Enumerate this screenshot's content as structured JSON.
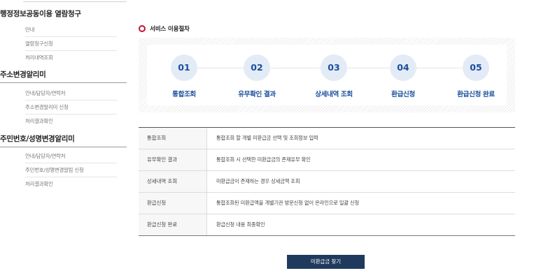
{
  "sidebar": {
    "sections": [
      {
        "title": "행정정보공동이용 열람청구",
        "items": [
          "안내",
          "열람청구신청",
          "처리내역조회"
        ]
      },
      {
        "title": "주소변경알리미",
        "items": [
          "안내/담당자/연락처",
          "주소변경알리미 신청",
          "처리결과확인"
        ]
      },
      {
        "title": "주민번호/성명변경알리미",
        "items": [
          "안내/담당자/연락처",
          "주민번호/성명변경알림 신청",
          "처리결과확인"
        ]
      }
    ]
  },
  "main": {
    "section_title": "서비스 이용절차",
    "steps": [
      {
        "num": "01",
        "label": "통합조회"
      },
      {
        "num": "02",
        "label": "유무확인 결과"
      },
      {
        "num": "03",
        "label": "상세내역 조회"
      },
      {
        "num": "04",
        "label": "환급신청"
      },
      {
        "num": "05",
        "label": "환급신청 완료"
      }
    ],
    "table": [
      {
        "head": "통합조회",
        "desc": "통합조회 할 개별 미환급금 선택 및 조회정보 입력"
      },
      {
        "head": "유무확인 결과",
        "desc": "통합조회 시 선택한 미환급금의 존재유무 확인"
      },
      {
        "head": "상세내역 조회",
        "desc": "미환급금이 존재하는 경우 상세금액 조회"
      },
      {
        "head": "환급신청",
        "desc": "통합조회된 미환급액을 개별기관 방문신청 없이 온라인으로 일괄 신청"
      },
      {
        "head": "환급신청 완료",
        "desc": "환급신청 내용 최종확인"
      }
    ],
    "button_label": "미환급금 찾기"
  },
  "colors": {
    "accent": "#1a4e9c",
    "bullet": "#c8102e",
    "button": "#1f3a5c"
  }
}
